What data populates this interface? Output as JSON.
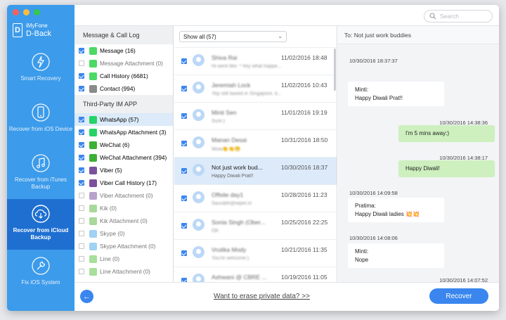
{
  "app": {
    "brand": "iMyFone",
    "product": "D-Back",
    "logo_letter": "D"
  },
  "nav": [
    {
      "label": "Smart Recovery",
      "icon": "lightning-refresh-icon"
    },
    {
      "label": "Recover from iOS Device",
      "icon": "phone-icon"
    },
    {
      "label": "Recover from iTunes Backup",
      "icon": "music-note-icon"
    },
    {
      "label": "Recover from iCloud Backup",
      "icon": "cloud-download-icon",
      "active": true
    },
    {
      "label": "Fix iOS System",
      "icon": "wrench-icon"
    }
  ],
  "search": {
    "placeholder": "Search"
  },
  "categories": {
    "section1": "Message & Call Log",
    "items1": [
      {
        "label": "Message (16)",
        "checked": true,
        "icon": "message-icon",
        "color": "#4cd964"
      },
      {
        "label": "Message Attachment (0)",
        "checked": false,
        "icon": "message-icon",
        "color": "#4cd964"
      },
      {
        "label": "Call History (6681)",
        "checked": true,
        "icon": "phone-icon",
        "color": "#4cd964"
      },
      {
        "label": "Contact (994)",
        "checked": true,
        "icon": "contact-icon",
        "color": "#8a8a8a"
      }
    ],
    "section2": "Third-Party IM APP",
    "items2": [
      {
        "label": "WhatsApp (57)",
        "checked": true,
        "icon": "whatsapp-icon",
        "color": "#25d366",
        "selected": true
      },
      {
        "label": "WhatsApp Attachment (3)",
        "checked": true,
        "icon": "whatsapp-icon",
        "color": "#25d366"
      },
      {
        "label": "WeChat (6)",
        "checked": true,
        "icon": "wechat-icon",
        "color": "#3cb034"
      },
      {
        "label": "WeChat Attachment (394)",
        "checked": true,
        "icon": "wechat-icon",
        "color": "#3cb034"
      },
      {
        "label": "Viber (5)",
        "checked": true,
        "icon": "viber-icon",
        "color": "#7b519d"
      },
      {
        "label": "Viber Call History (17)",
        "checked": true,
        "icon": "viber-icon",
        "color": "#7b519d"
      },
      {
        "label": "Viber Attachment (0)",
        "checked": false,
        "icon": "viber-icon",
        "color": "#b7a2cb"
      },
      {
        "label": "Kik (0)",
        "checked": false,
        "icon": "kik-icon",
        "color": "#a8d89a"
      },
      {
        "label": "Kik Attachment (0)",
        "checked": false,
        "icon": "kik-icon",
        "color": "#a8d89a"
      },
      {
        "label": "Skype (0)",
        "checked": false,
        "icon": "skype-icon",
        "color": "#9fd2f3"
      },
      {
        "label": "Skype Attachment (0)",
        "checked": false,
        "icon": "skype-icon",
        "color": "#9fd2f3"
      },
      {
        "label": "Line (0)",
        "checked": false,
        "icon": "line-icon",
        "color": "#a8df9a"
      },
      {
        "label": "Line Attachment (0)",
        "checked": false,
        "icon": "line-icon",
        "color": "#a8df9a"
      }
    ]
  },
  "messages": {
    "filter": "Show all (57)",
    "rows": [
      {
        "name": "Shiva Rai",
        "preview": "Hi went like: * hey what happe...",
        "date": "11/02/2016 18:48",
        "blur": true
      },
      {
        "name": "Jeremiah Lock",
        "preview": "Yep still based in Singapore, b...",
        "date": "11/02/2016 10:43",
        "blur": true
      },
      {
        "name": "Minti Sen",
        "preview": "Sure:)",
        "date": "11/01/2016 19:19",
        "blur": true
      },
      {
        "name": "Manan Desai",
        "preview": "Wow👏👏😁",
        "date": "10/31/2016 18:50",
        "blur": true
      },
      {
        "name": "Not just work bud...",
        "preview": "Happy Diwali Prat!!",
        "date": "10/30/2016 18:37",
        "blur": false,
        "selected": true
      },
      {
        "name": "Offsite day1",
        "preview": "Saurabh@wiper.in",
        "date": "10/28/2016 11:23",
        "blur": true
      },
      {
        "name": "Sonia Singh (Ober...",
        "preview": "OK",
        "date": "10/25/2016 22:25",
        "blur": true
      },
      {
        "name": "Vrutika Mody",
        "preview": "You're welcome:)",
        "date": "10/21/2016 11:35",
        "blur": true
      },
      {
        "name": "Ashwani @ CBRE ...",
        "preview": "",
        "date": "10/19/2016 11:05",
        "blur": true
      }
    ]
  },
  "chat": {
    "to": "To:  Not just work buddies",
    "items": [
      {
        "ts": "10/30/2016 18:37:37",
        "side": "in",
        "sender": "Minti:",
        "text": "Happy Diwali Prat!!"
      },
      {
        "ts": "10/30/2016 14:38:36",
        "side": "out",
        "text": "I'm 5 mins away:)"
      },
      {
        "ts": "10/30/2016 14:38:17",
        "side": "out",
        "text": "Happy Diwali!"
      },
      {
        "ts": "10/30/2016 14:09:58",
        "side": "in",
        "sender": "Pratima:",
        "text": "Happy Diwali ladies 💥💥"
      },
      {
        "ts": "10/30/2016 14:08:06",
        "side": "in",
        "sender": "Minti:",
        "text": "Nope"
      },
      {
        "ts": "10/30/2016 14:07:52",
        "side": "out",
        "text": ""
      }
    ]
  },
  "footer": {
    "erase": "Want to erase private data? >>",
    "recover": "Recover"
  },
  "colors": {
    "sidebar": "#3c9bea",
    "sidebar_active": "#1f6fd1",
    "accent": "#3a86ee",
    "bubble_out": "#cdf0be"
  }
}
